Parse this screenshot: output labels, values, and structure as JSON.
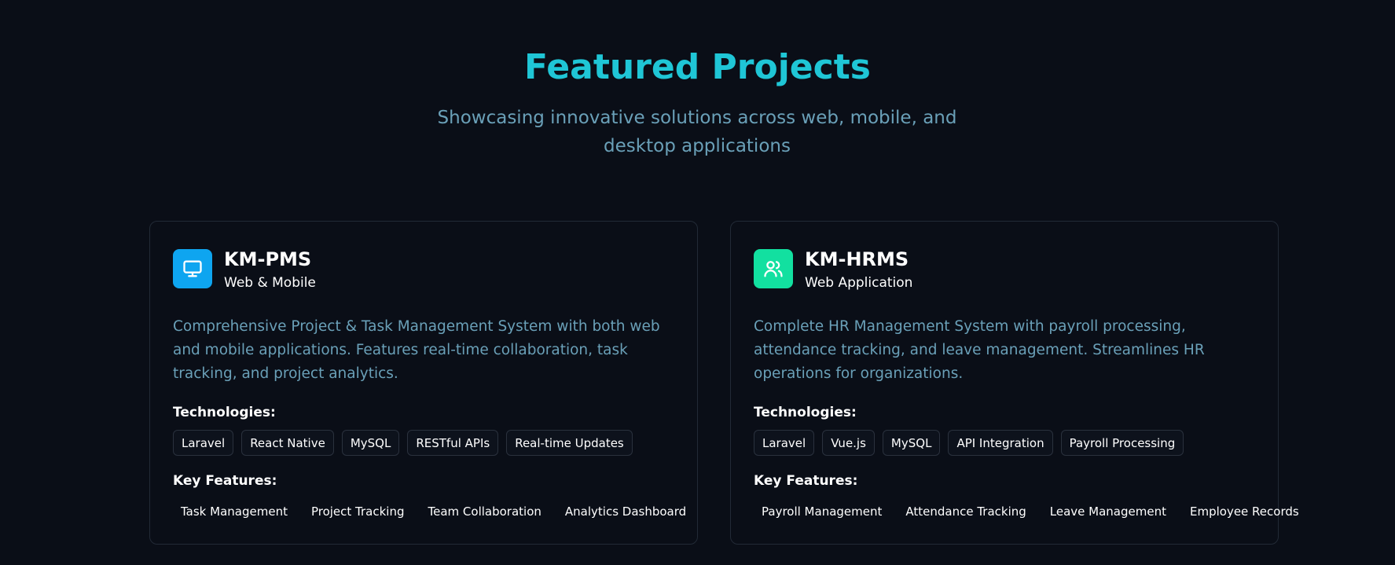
{
  "section": {
    "title": "Featured Projects",
    "subtitle": "Showcasing innovative solutions across web, mobile, and desktop applications"
  },
  "projects": [
    {
      "name": "KM-PMS",
      "type": "Web & Mobile",
      "icon": "monitor-icon",
      "icon_color": "#0ea5f0",
      "description": "Comprehensive Project & Task Management System with both web and mobile applications. Features real-time collaboration, task tracking, and project analytics.",
      "technologies_label": "Technologies:",
      "technologies": [
        "Laravel",
        "React Native",
        "MySQL",
        "RESTful APIs",
        "Real-time Updates"
      ],
      "features_label": "Key Features:",
      "features": [
        "Task Management",
        "Project Tracking",
        "Team Collaboration",
        "Analytics Dashboard"
      ]
    },
    {
      "name": "KM-HRMS",
      "type": "Web Application",
      "icon": "users-icon",
      "icon_color": "#12e0a0",
      "description": "Complete HR Management System with payroll processing, attendance tracking, and leave management. Streamlines HR operations for organizations.",
      "technologies_label": "Technologies:",
      "technologies": [
        "Laravel",
        "Vue.js",
        "MySQL",
        "API Integration",
        "Payroll Processing"
      ],
      "features_label": "Key Features:",
      "features": [
        "Payroll Management",
        "Attendance Tracking",
        "Leave Management",
        "Employee Records"
      ]
    }
  ]
}
